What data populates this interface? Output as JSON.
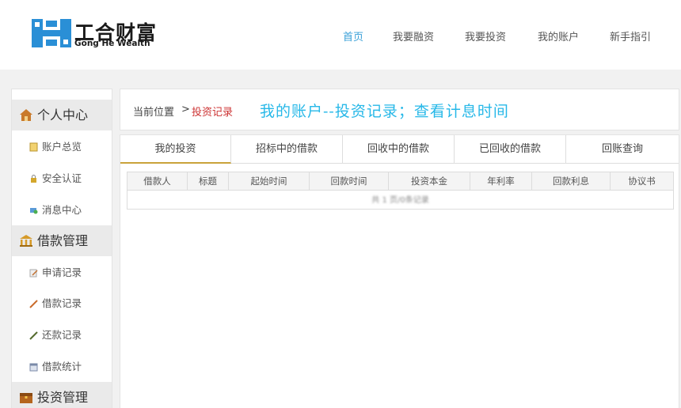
{
  "logo": {
    "cn": "工合财富",
    "en": "Gong He Wealth"
  },
  "nav": [
    "首页",
    "我要融资",
    "我要投资",
    "我的账户",
    "新手指引"
  ],
  "breadcrumb": {
    "label": "当前位置",
    "sep": ">",
    "current": "投资记录"
  },
  "annotation": "我的账户--投资记录；查看计息时间",
  "sidebar": {
    "groups": [
      {
        "title": "个人中心",
        "items": [
          "账户总览",
          "安全认证",
          "消息中心"
        ]
      },
      {
        "title": "借款管理",
        "items": [
          "申请记录",
          "借款记录",
          "还款记录",
          "借款统计"
        ]
      },
      {
        "title": "投资管理",
        "items": []
      }
    ]
  },
  "tabs": [
    "我的投资",
    "招标中的借款",
    "回收中的借款",
    "已回收的借款",
    "回账查询"
  ],
  "table": {
    "columns": [
      "借款人",
      "标题",
      "起始时间",
      "回款时间",
      "投资本金",
      "年利率",
      "回款利息",
      "协议书"
    ],
    "empty_text": "共 1 页/0条记录"
  },
  "colors": {
    "nav_active": "#3aa0d8",
    "crumb_current": "#cc3333",
    "annotation": "#27b8e8",
    "tab_active_underline": "#c9a23a"
  }
}
